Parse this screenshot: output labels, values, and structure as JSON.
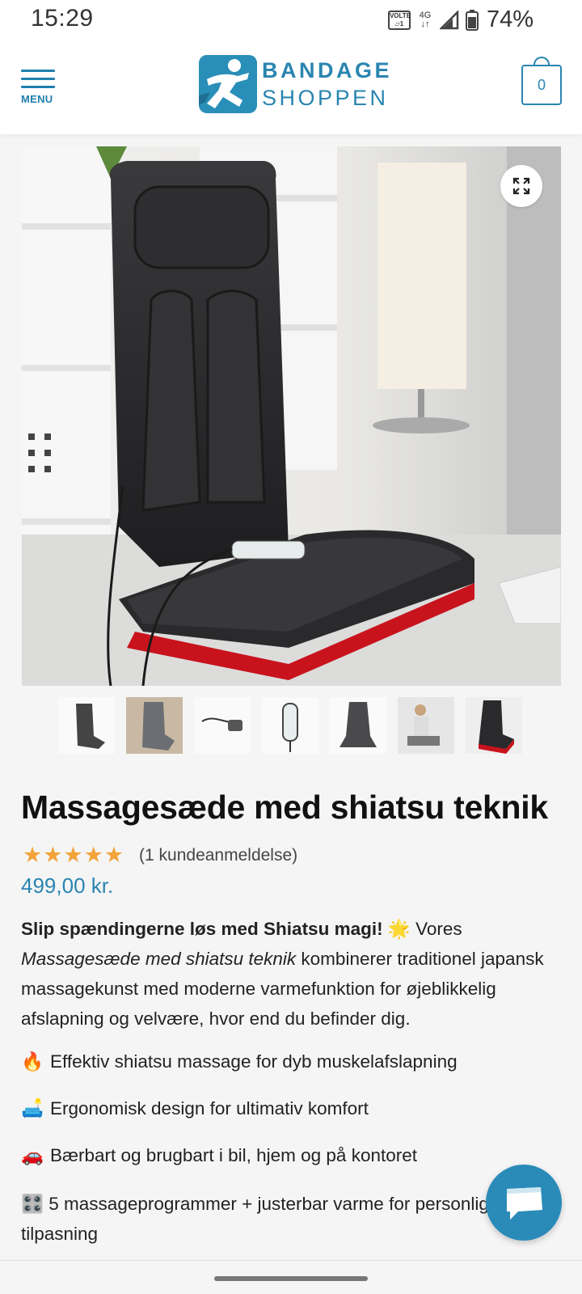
{
  "status_bar": {
    "time": "15:29",
    "volte": "VOLTE",
    "network": "4G",
    "battery": "74%"
  },
  "header": {
    "menu_label": "MENU",
    "logo_line1": "BANDAGE",
    "logo_line2": "SHOPPEN",
    "cart_count": "0"
  },
  "product": {
    "title": "Massagesæde med shiatsu teknik",
    "rating": 5,
    "reviews_label": "(1 kundeanmeldelse)",
    "price": "499,00 kr.",
    "intro_bold": "Slip spændingerne løs med Shiatsu magi!",
    "intro_emoji": "🌟",
    "intro_vores": " Vores ",
    "intro_italic": "Massagesæde med shiatsu teknik",
    "intro_rest": " kombinerer traditionel japansk massagekunst med moderne varmefunktion for øjeblikkelig afslapning og velvære, hvor end du befinder dig.",
    "bullets": [
      {
        "emoji": "🔥",
        "text": "Effektiv shiatsu massage for dyb muskelafslapning"
      },
      {
        "emoji": "🛋️",
        "text": "Ergonomisk design for ultimativ komfort"
      },
      {
        "emoji": "🚗",
        "text": "Bærbart og brugbart i bil, hjem og på kontoret"
      },
      {
        "emoji": "🎛️",
        "text": "5 massageprogrammer + justerbar varme for personlig tilpasning"
      }
    ],
    "thumbnails": [
      "seat-front",
      "seat-in-car",
      "car-adapter",
      "remote-control",
      "seat-back",
      "person-on-seat",
      "seat-on-chair"
    ]
  },
  "colors": {
    "accent": "#2a85b0",
    "star": "#f2a33a",
    "chat": "#2a8bb9"
  }
}
